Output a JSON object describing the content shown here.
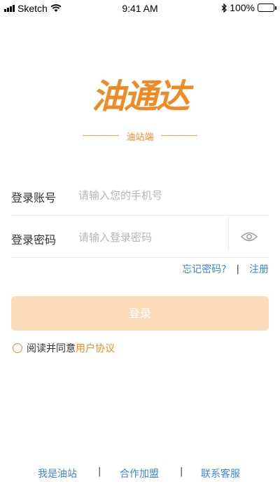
{
  "status_bar": {
    "carrier": "Sketch",
    "time": "9:41 AM",
    "battery": "100%"
  },
  "logo": {
    "title": "油通达",
    "subtitle": "油站端"
  },
  "form": {
    "account_label": "登录账号",
    "account_placeholder": "请输入您的手机号",
    "password_label": "登录密码",
    "password_placeholder": "请输入登录密码"
  },
  "links": {
    "forgot": "忘记密码?",
    "separator": "|",
    "register": "注册"
  },
  "login_button": "登录",
  "agreement": {
    "text": "阅读并同意",
    "link": "用户协议"
  },
  "footer": {
    "items": [
      "我是油站",
      "合作加盟",
      "联系客服"
    ],
    "separator": "|"
  },
  "colors": {
    "accent": "#f08a24",
    "link": "#3d86d6",
    "button_disabled": "#fddcb9"
  }
}
